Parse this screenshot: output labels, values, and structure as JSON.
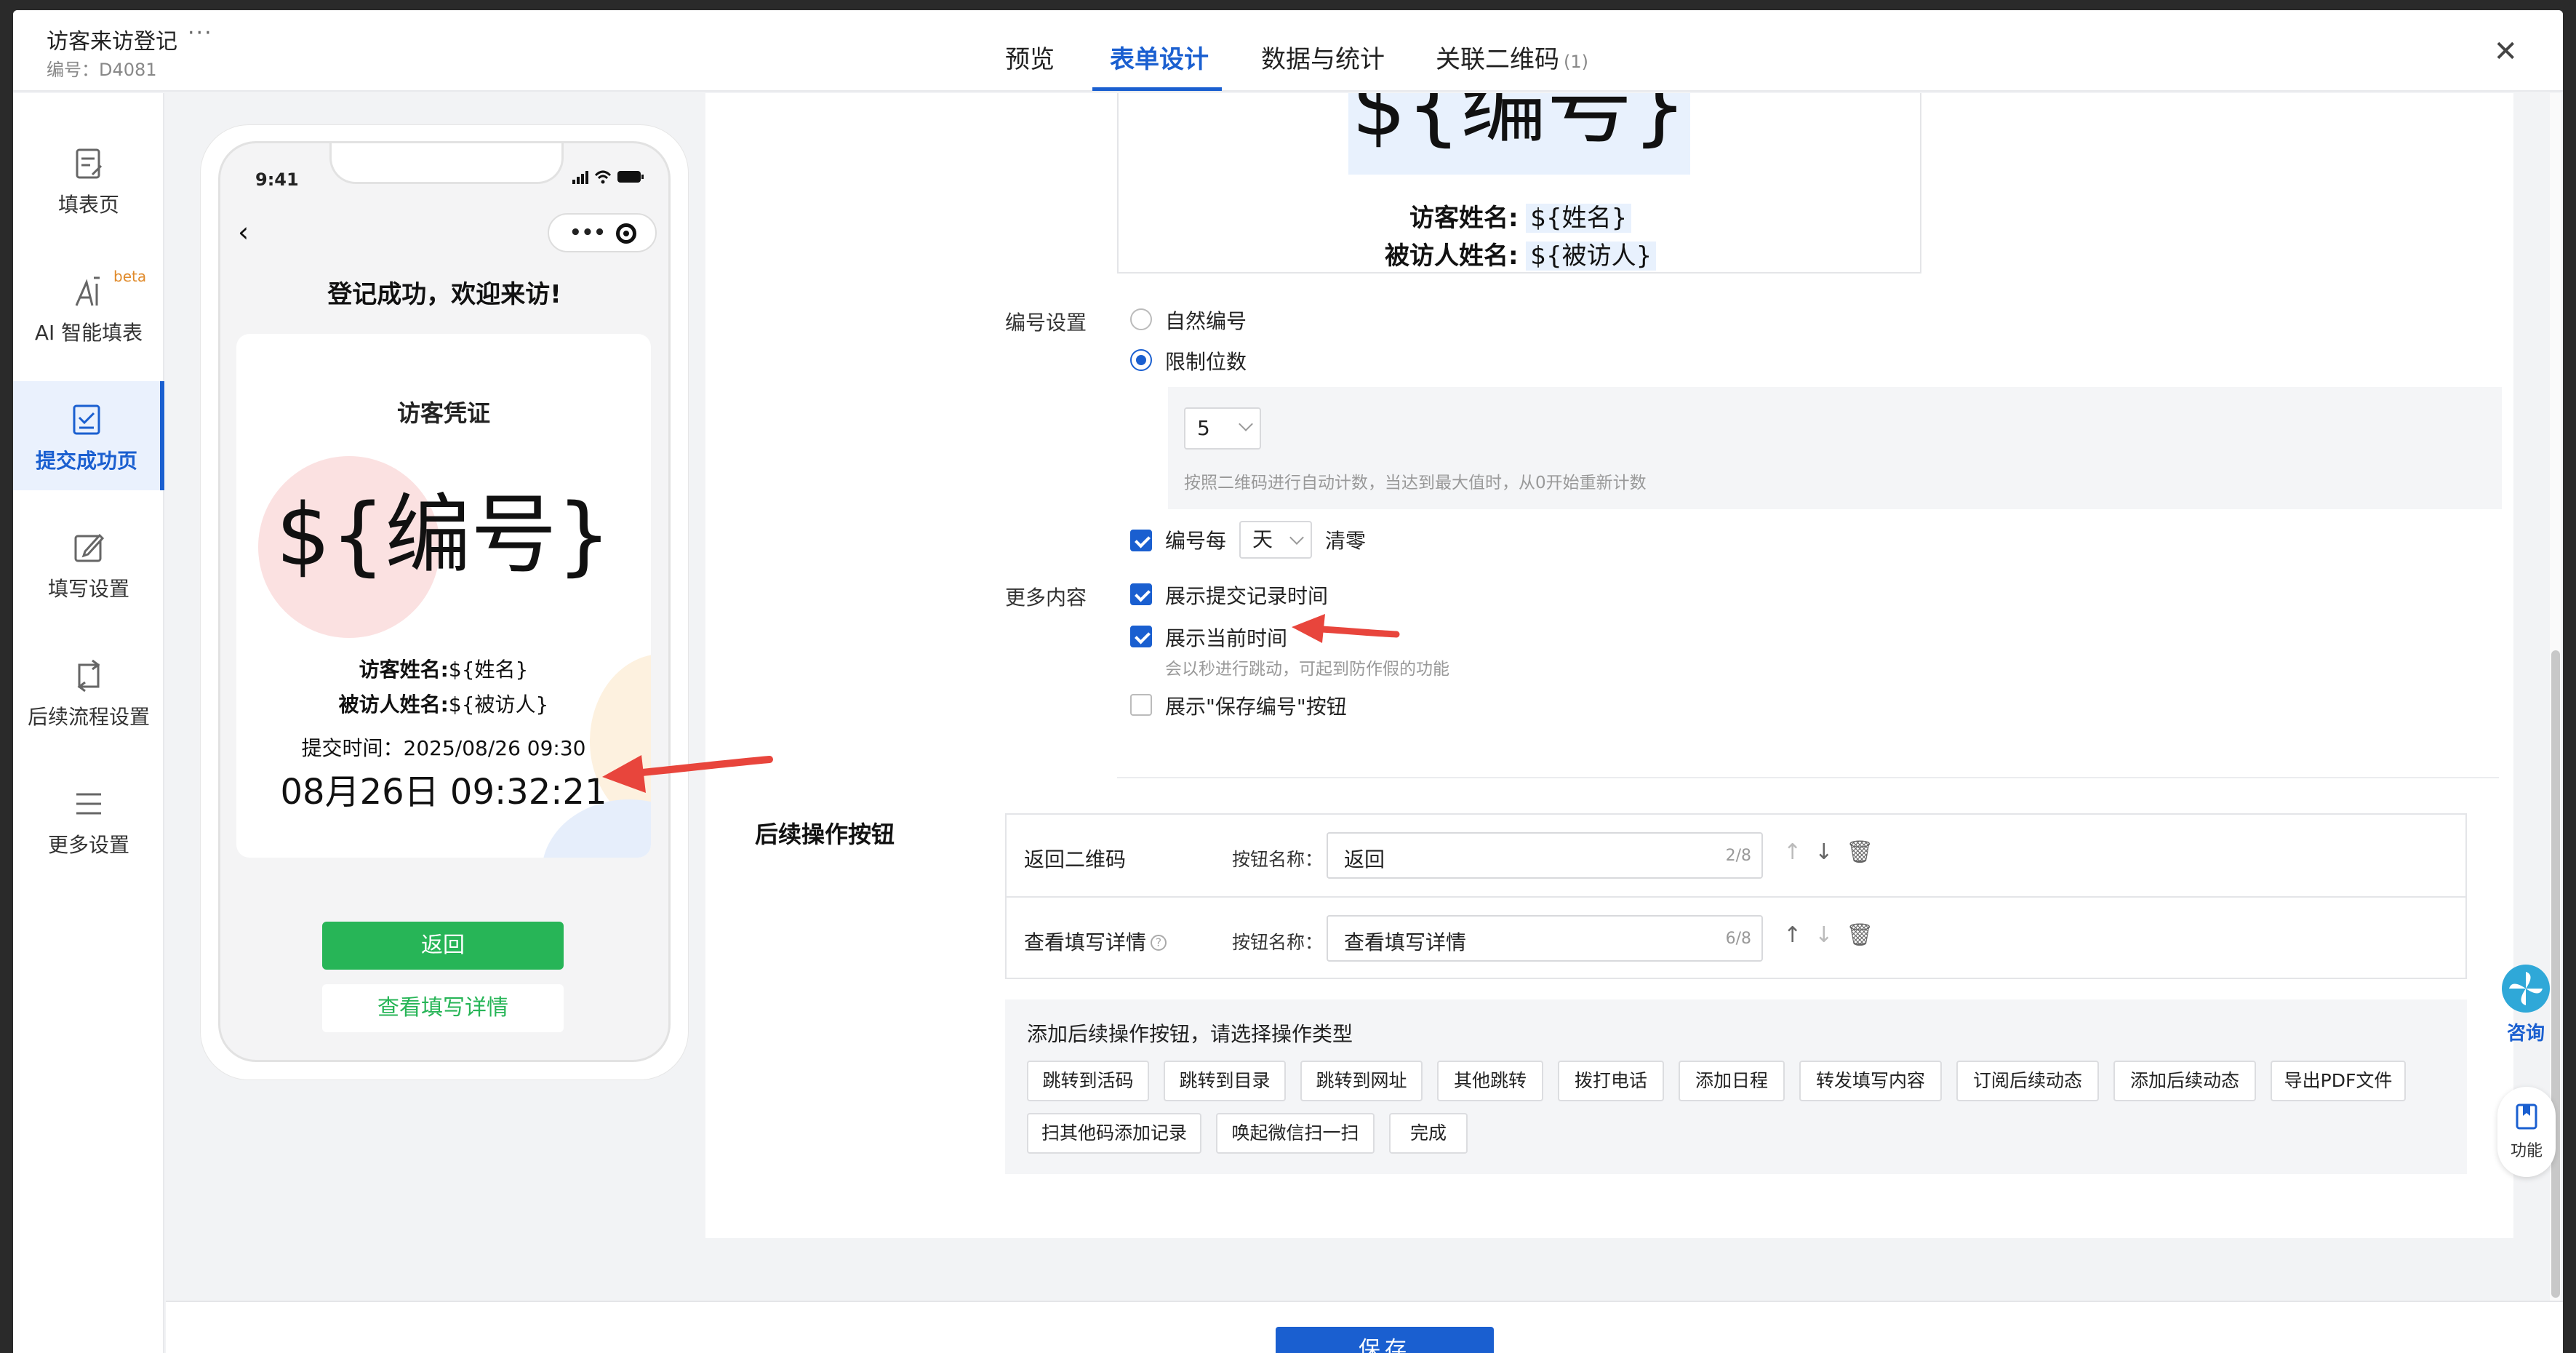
{
  "header": {
    "title": "访客来访登记",
    "more": "···",
    "code": "编号：D4081",
    "tabs": [
      {
        "label": "预览"
      },
      {
        "label": "表单设计"
      },
      {
        "label": "数据与统计"
      },
      {
        "label": "关联二维码",
        "count": "(1)"
      }
    ],
    "close": "✕"
  },
  "sidebar": {
    "items": [
      {
        "label": "填表页"
      },
      {
        "label": "AI 智能填表",
        "badge": "beta"
      },
      {
        "label": "提交成功页"
      },
      {
        "label": "填写设置"
      },
      {
        "label": "后续流程设置"
      },
      {
        "label": "更多设置"
      }
    ]
  },
  "phone": {
    "time": "9:41",
    "success_title": "登记成功，欢迎来访!",
    "ticket_title": "访客凭证",
    "ticket_code": "${编号}",
    "visitor_label": "访客姓名:",
    "visitor_value": "${姓名}",
    "host_label": "被访人姓名:",
    "host_value": "${被访人}",
    "submit_time": "提交时间：2025/08/26 09:30",
    "clock": "08月26日 09:32:21",
    "btn_back": "返回",
    "btn_detail": "查看填写详情"
  },
  "preview": {
    "code": "${编号}",
    "visitor_label": "访客姓名:",
    "visitor_value": "${姓名}",
    "host_label": "被访人姓名:",
    "host_value": "${被访人}"
  },
  "numbering": {
    "label": "编号设置",
    "opt_natural": "自然编号",
    "opt_limit": "限制位数",
    "digits": "5",
    "hint": "按照二维码进行自动计数，当达到最大值时，从0开始重新计数",
    "reset_prefix": "编号每",
    "reset_unit": "天",
    "reset_suffix": "清零"
  },
  "more": {
    "label": "更多内容",
    "show_submit_time": "展示提交记录时间",
    "show_current_time": "展示当前时间",
    "current_time_hint": "会以秒进行跳动，可起到防作假的功能",
    "show_save_btn": "展示\"保存编号\"按钮"
  },
  "after": {
    "title": "后续操作按钮",
    "name_label": "按钮名称：",
    "rows": [
      {
        "name": "返回二维码",
        "value": "返回",
        "count": "2/8"
      },
      {
        "name": "查看填写详情",
        "value": "查看填写详情",
        "count": "6/8"
      }
    ],
    "add_title": "添加后续操作按钮，请选择操作类型",
    "types": [
      "跳转到活码",
      "跳转到目录",
      "跳转到网址",
      "其他跳转",
      "拨打电话",
      "添加日程",
      "转发填写内容",
      "订阅后续动态",
      "添加后续动态",
      "导出PDF文件",
      "扫其他码添加记录",
      "唤起微信扫一扫",
      "完成"
    ]
  },
  "footer": {
    "save": "保存"
  },
  "float": {
    "consult": "咨询",
    "func": "功能"
  },
  "colors": {
    "primary": "#1a5fd0",
    "green": "#27b557",
    "arrow": "#e8453c"
  }
}
